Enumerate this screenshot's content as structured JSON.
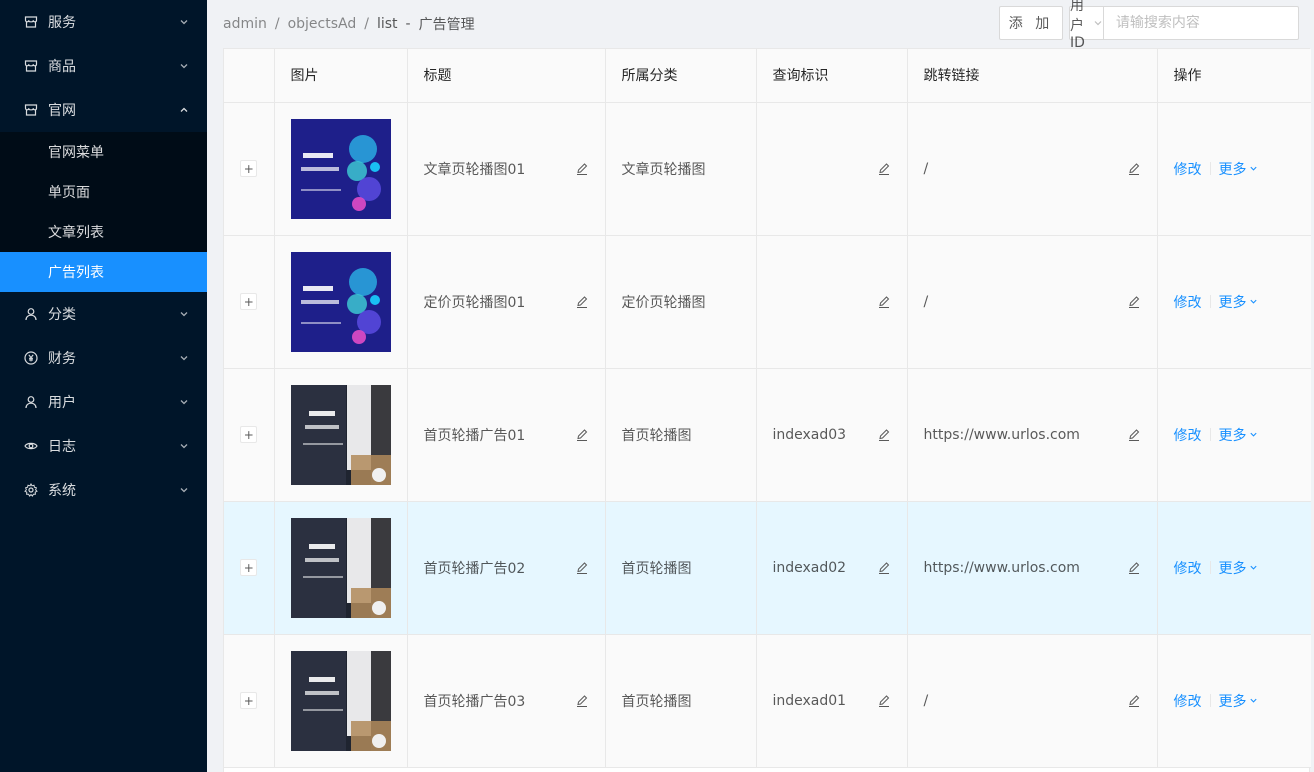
{
  "sidebar": {
    "items": [
      {
        "label": "服务",
        "icon": "store-icon",
        "expanded": false
      },
      {
        "label": "商品",
        "icon": "store-icon",
        "expanded": false
      },
      {
        "label": "官网",
        "icon": "store-icon",
        "expanded": true
      },
      {
        "label": "分类",
        "icon": "user-icon",
        "expanded": false
      },
      {
        "label": "财务",
        "icon": "yen-icon",
        "expanded": false
      },
      {
        "label": "用户",
        "icon": "user-icon",
        "expanded": false
      },
      {
        "label": "日志",
        "icon": "eye-icon",
        "expanded": false
      },
      {
        "label": "系统",
        "icon": "gear-icon",
        "expanded": false
      }
    ],
    "submenu": [
      {
        "label": "官网菜单"
      },
      {
        "label": "单页面"
      },
      {
        "label": "文章列表"
      },
      {
        "label": "广告列表",
        "active": true
      }
    ]
  },
  "breadcrumb": [
    "admin",
    "objectsAd",
    "list",
    "广告管理"
  ],
  "breadcrumb_dash": "-",
  "toolbar": {
    "add_label": "添 加",
    "filter_label": "用户ID",
    "search_placeholder": "请输搜索内容"
  },
  "table": {
    "columns": [
      "图片",
      "标题",
      "所属分类",
      "查询标识",
      "跳转链接",
      "操作"
    ],
    "expand_symbol": "+",
    "rows": [
      {
        "image": "blue-banner",
        "title": "文章页轮播图01",
        "category": "文章页轮播图",
        "key": "",
        "link": "/",
        "edit": "修改",
        "more": "更多"
      },
      {
        "image": "blue-banner",
        "title": "定价页轮播图01",
        "category": "定价页轮播图",
        "key": "",
        "link": "/",
        "edit": "修改",
        "more": "更多"
      },
      {
        "image": "dark-banner",
        "title": "首页轮播广告01",
        "category": "首页轮播图",
        "key": "indexad03",
        "link": "https://www.urlos.com",
        "edit": "修改",
        "more": "更多"
      },
      {
        "image": "dark-banner",
        "title": "首页轮播广告02",
        "category": "首页轮播图",
        "key": "indexad02",
        "link": "https://www.urlos.com",
        "edit": "修改",
        "more": "更多",
        "hovered": true
      },
      {
        "image": "dark-banner",
        "title": "首页轮播广告03",
        "category": "首页轮播图",
        "key": "indexad01",
        "link": "/",
        "edit": "修改",
        "more": "更多"
      }
    ]
  },
  "colors": {
    "sidebar_bg": "#001529",
    "submenu_bg": "#000c17",
    "accent": "#1890ff",
    "row_hover": "#e6f7ff"
  }
}
